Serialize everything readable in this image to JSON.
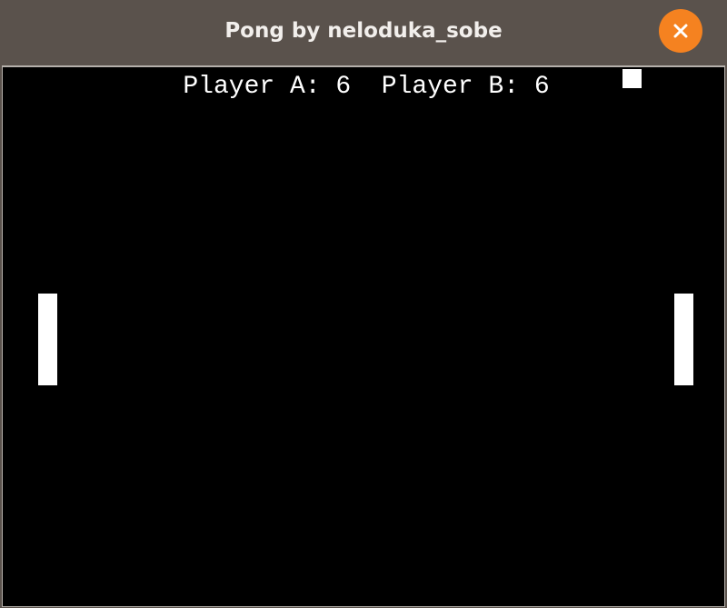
{
  "window": {
    "title": "Pong by neloduka_sobe",
    "close_icon": "close-icon",
    "accent_color": "#f58220"
  },
  "game": {
    "score_text": "Player A: 6  Player B: 6",
    "player_a": {
      "label": "Player A",
      "score": 6
    },
    "player_b": {
      "label": "Player B",
      "score": 6
    },
    "background_color": "#000000",
    "foreground_color": "#ffffff"
  }
}
